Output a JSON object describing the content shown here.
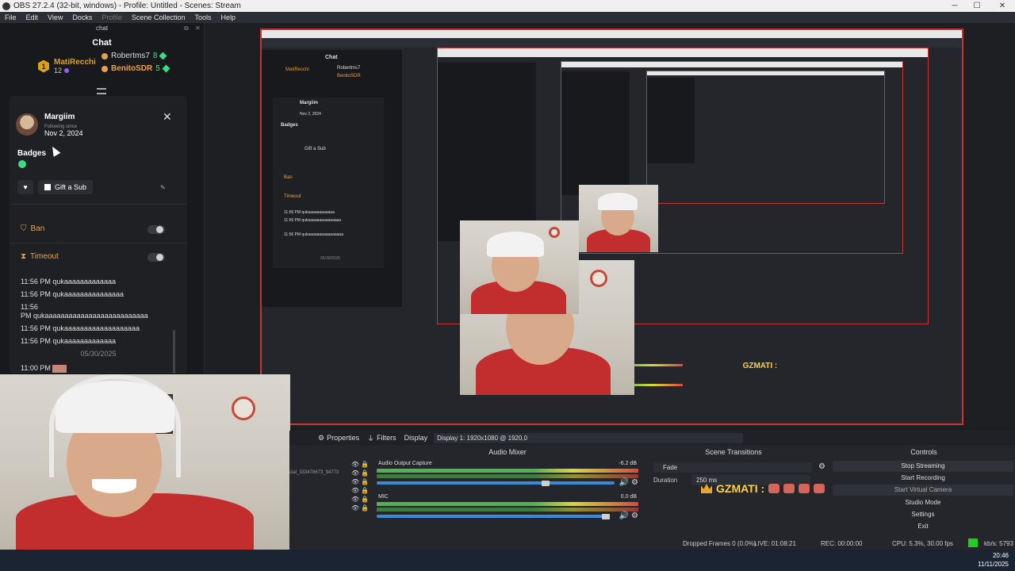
{
  "window": {
    "title": "OBS 27.2.4 (32-bit, windows) - Profile: Untitled - Scenes: Stream",
    "controls": [
      "─",
      "☐",
      "✕"
    ]
  },
  "menubar": {
    "items": [
      "File",
      "Edit",
      "View",
      "Docks",
      "Profile",
      "Scene Collection",
      "Tools",
      "Help"
    ]
  },
  "chat_dock": {
    "dock_title": "chat",
    "header": "Chat",
    "leaderboard": {
      "first": {
        "rank": "1",
        "name": "MatiRecchi",
        "count": "12"
      },
      "others": [
        {
          "name": "Robertms7",
          "count": "8",
          "color": "#e7a14b"
        },
        {
          "name": "BenitoSDR",
          "count": "5",
          "color": "#e7a14b"
        }
      ]
    },
    "user_card": {
      "name": "Margiim",
      "following_label": "Following since",
      "following_date": "Nov 2, 2024",
      "badges_label": "Badges",
      "gift_label": "Gift a Sub",
      "ban_label": "Ban",
      "timeout_label": "Timeout",
      "messages": [
        {
          "time": "11:56 PM",
          "text": "qukaaaaaaaaaaaaa"
        },
        {
          "time": "11:56 PM",
          "text": "qukaaaaaaaaaaaaaaa"
        },
        {
          "time": "11:56",
          "time2": "PM",
          "text": "qukaaaaaaaaaaaaaaaaaaaaaaaaaa"
        },
        {
          "time": "11:56 PM",
          "text": "qukaaaaaaaaaaaaaaaaaaa"
        },
        {
          "time": "11:56 PM",
          "text": "qukaaaaaaaaaaaaa"
        }
      ],
      "date_separator": "05/30/2025",
      "last_message_time": "11:00 PM"
    }
  },
  "bottom": {
    "toolbar": {
      "properties": "Properties",
      "filters": "Filters",
      "display": "Display",
      "display_value": "Display 1: 1920x1080 @ 1920,0"
    },
    "audio_mixer": {
      "title": "Audio Mixer",
      "channels": [
        {
          "name": "Audio Output Capture",
          "db": "-6.2 dB"
        },
        {
          "name": "MIC",
          "db": "0.0 dB"
        }
      ],
      "source_label": "cial_333478673_94773"
    },
    "scene_transitions": {
      "title": "Scene Transitions",
      "selected": "Fade",
      "duration_label": "Duration",
      "duration_value": "250 ms"
    },
    "overlay_text": "GZMATI :",
    "controls": {
      "title": "Controls",
      "buttons": [
        "Stop Streaming",
        "Start Recording",
        "Start Virtual Camera",
        "Studio Mode",
        "Settings",
        "Exit"
      ]
    }
  },
  "statusbar": {
    "dropped": "Dropped Frames 0 (0.0%)",
    "live": "LIVE: 01:08:21",
    "rec": "REC: 00:00:00",
    "cpu": "CPU: 5.3%, 30.00 fps",
    "kbps": "kb/s: 5793"
  },
  "taskbar": {
    "time": "20:46",
    "date": "11/11/2025"
  },
  "colors": {
    "accent_red": "#c93535",
    "gold": "#d9a21b",
    "green": "#3ddc84",
    "orange": "#e7a14b"
  }
}
